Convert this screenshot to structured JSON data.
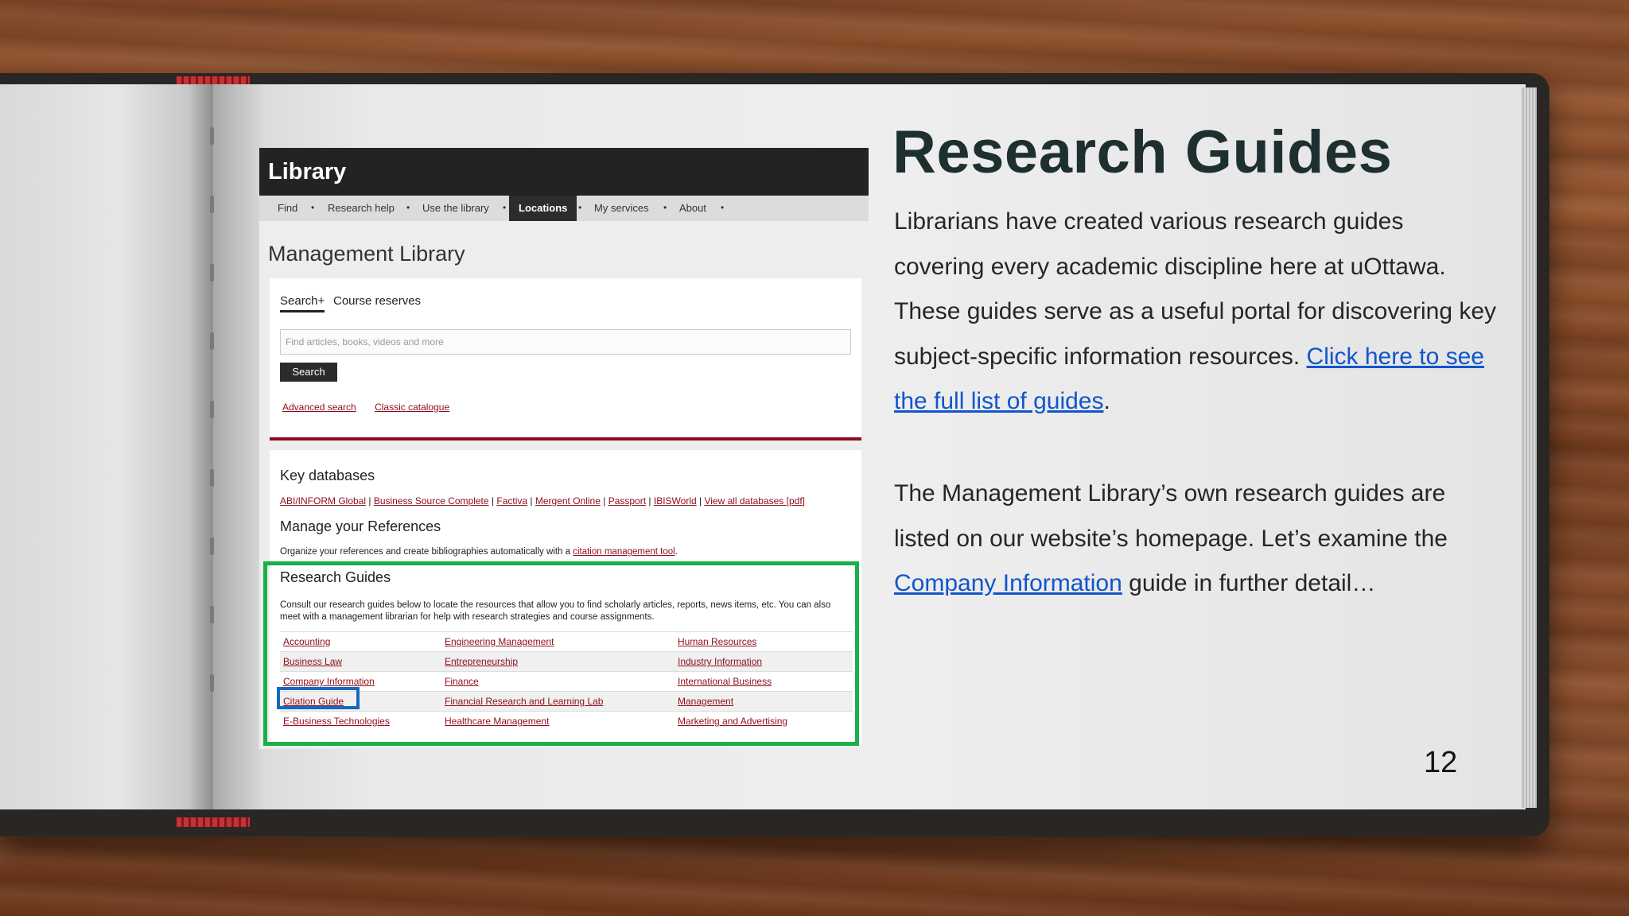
{
  "library": {
    "title": "Library",
    "nav": [
      "Find",
      "Research help",
      "Use the library",
      "Locations",
      "My services",
      "About"
    ],
    "page_title": "Management Library",
    "search": {
      "tab_active": "Search+",
      "tab_other": "Course reserves",
      "placeholder": "Find articles, books, videos and more",
      "button": "Search",
      "links": [
        "Advanced search",
        "Classic catalogue"
      ]
    },
    "key_databases": {
      "heading": "Key databases",
      "links": [
        "ABI/INFORM Global",
        "Business Source Complete",
        "Factiva",
        "Mergent Online",
        "Passport",
        "IBISWorld",
        "View all databases [pdf]"
      ]
    },
    "references": {
      "heading": "Manage your References",
      "text": "Organize your references and create bibliographies automatically with a",
      "link": "citation management tool",
      "end": "."
    },
    "research_guides": {
      "heading": "Research Guides",
      "description": "Consult our research guides below to locate the resources that allow you to find scholarly articles, reports, news items, etc. You can also meet with a management librarian for help with research strategies and course assignments.",
      "rows": [
        [
          "Accounting",
          "Engineering Management",
          "Human Resources"
        ],
        [
          "Business Law",
          "Entrepreneurship",
          "Industry Information"
        ],
        [
          "Company Information",
          "Finance",
          "International Business"
        ],
        [
          "Citation Guide",
          "Financial Research and Learning Lab",
          "Management"
        ],
        [
          "E-Business Technologies",
          "Healthcare Management",
          "Marketing and Advertising"
        ]
      ]
    }
  },
  "slide": {
    "title": "Research Guides",
    "para1": "Librarians have created various research guides covering every academic discipline here at uOttawa. These guides serve as a useful portal for discovering key subject-specific information resources. ",
    "para1_link": "Click here to see the full list of guides",
    "para1_end": ".",
    "para2_start": "The Management Library’s own research guides are listed on our website’s homepage. Let’s examine the ",
    "para2_link": "Company Information",
    "para2_end": " guide in further detail…",
    "page_number": "12"
  },
  "colors": {
    "highlight_green": "#18b04a",
    "highlight_blue": "#1568c0",
    "library_red": "#8f0d1a",
    "link_blue": "#1155cc"
  }
}
